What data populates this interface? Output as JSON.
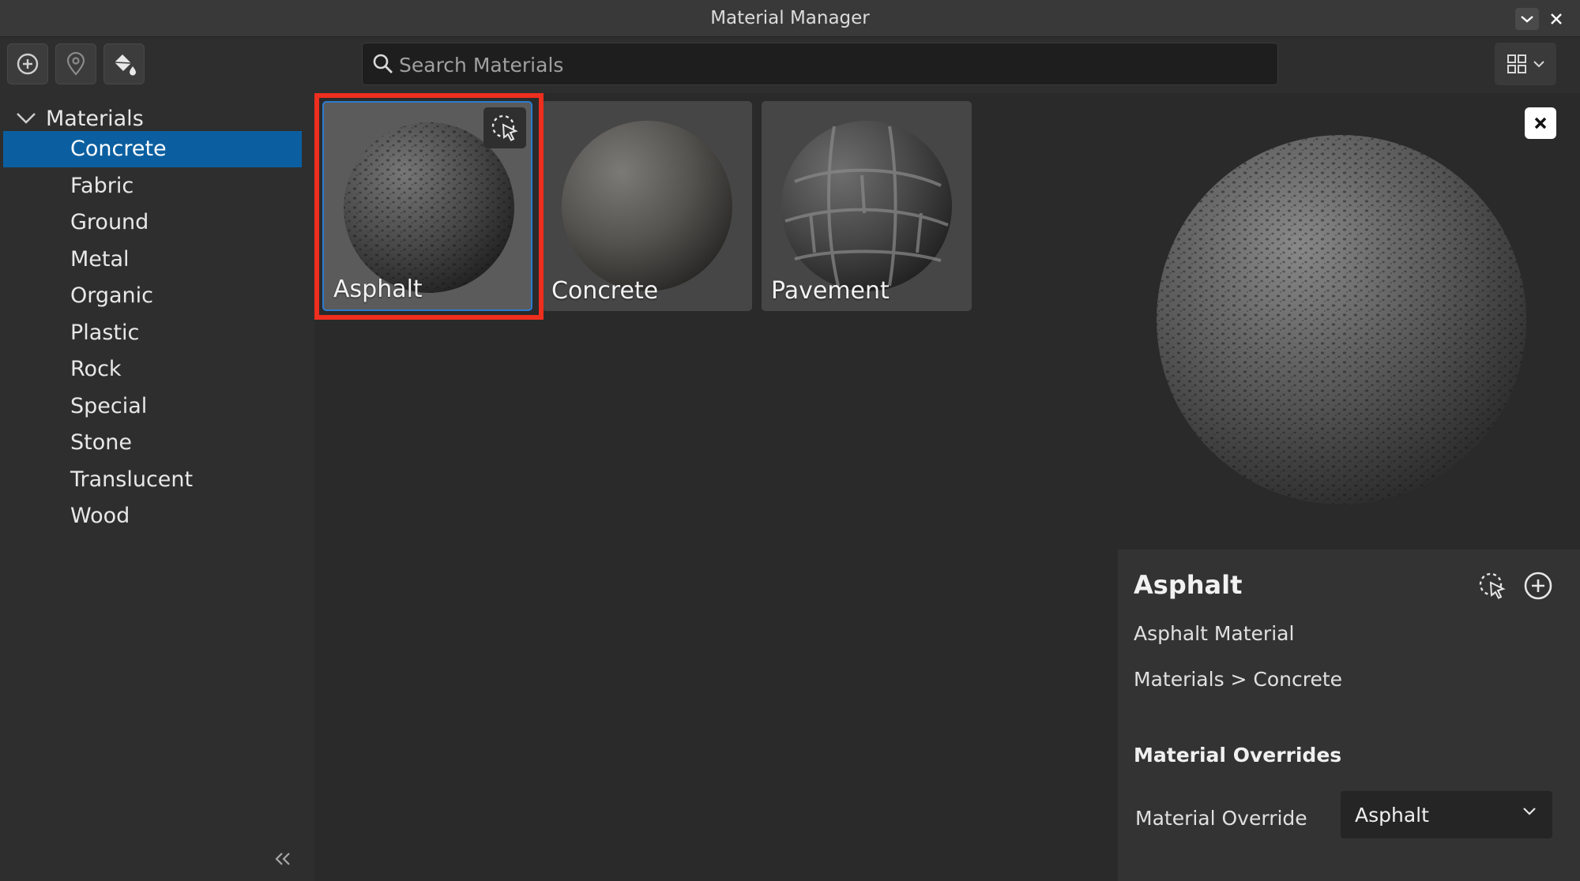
{
  "window": {
    "title": "Material Manager"
  },
  "toolbar": {
    "search_placeholder": "Search Materials",
    "search_value": ""
  },
  "sidebar": {
    "root_label": "Materials",
    "items": [
      {
        "label": "Concrete",
        "selected": true
      },
      {
        "label": "Fabric"
      },
      {
        "label": "Ground"
      },
      {
        "label": "Metal"
      },
      {
        "label": "Organic"
      },
      {
        "label": "Plastic"
      },
      {
        "label": "Rock"
      },
      {
        "label": "Special"
      },
      {
        "label": "Stone"
      },
      {
        "label": "Translucent"
      },
      {
        "label": "Wood"
      }
    ]
  },
  "grid": {
    "tiles": [
      {
        "label": "Asphalt",
        "selected": true
      },
      {
        "label": "Concrete"
      },
      {
        "label": "Pavement"
      }
    ]
  },
  "details": {
    "name": "Asphalt",
    "description": "Asphalt Material",
    "path": "Materials > Concrete",
    "overrides_title": "Material Overrides",
    "override_label": "Material Override",
    "override_value": "Asphalt"
  },
  "colors": {
    "accent": "#0b5fa0",
    "highlight": "#ee2e1e",
    "background": "#2e2e2e"
  }
}
